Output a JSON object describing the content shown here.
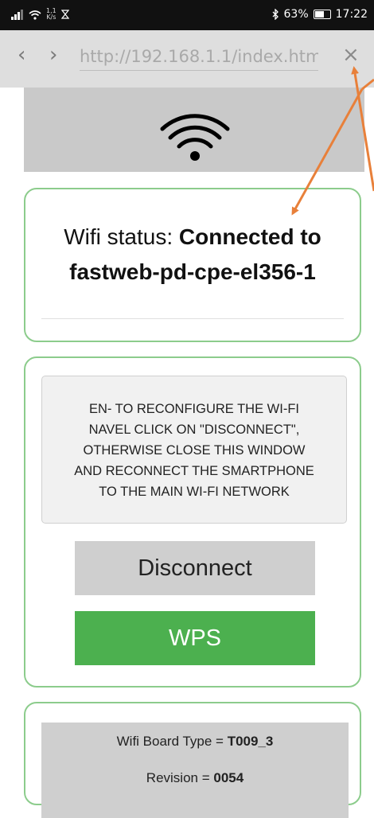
{
  "status_bar": {
    "net_speed_top": "1,1",
    "net_speed_bottom": "K/s",
    "battery": "63%",
    "battery_level": 0.63,
    "time": "17:22"
  },
  "browser": {
    "back_icon": "‹",
    "forward_icon": "›",
    "url": "http://192.168.1.1/index.htm",
    "close_icon": "×"
  },
  "wifi_status": {
    "label": "Wifi status: ",
    "value_line1": "Connected to",
    "value_line2": "fastweb-pd-cpe-el356-1"
  },
  "instructions": [
    "EN- TO RECONFIGURE THE WI-FI",
    "NAVEL CLICK ON \"DISCONNECT\",",
    "OTHERWISE CLOSE THIS WINDOW",
    "AND RECONNECT THE SMARTPHONE",
    "TO THE MAIN WI-FI NETWORK"
  ],
  "buttons": {
    "disconnect": "Disconnect",
    "wps": "WPS"
  },
  "board": {
    "type_label": "Wifi Board Type = ",
    "type_value": "T009_3",
    "revision_label": "Revision = ",
    "revision_value": "0054"
  },
  "colors": {
    "card_border": "#8ccc8c",
    "wps_green": "#4cb04f",
    "arrow": "#e8803a"
  }
}
